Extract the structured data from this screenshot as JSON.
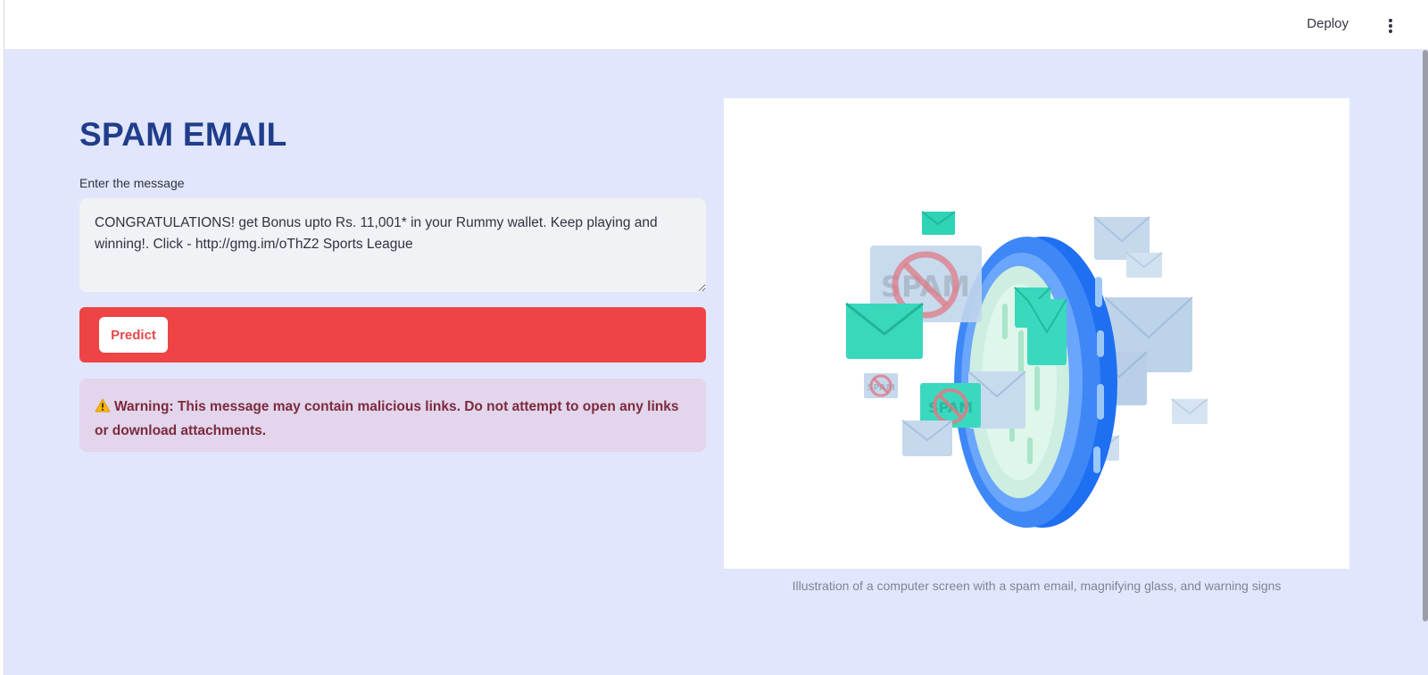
{
  "header": {
    "deploy_label": "Deploy",
    "menu_icon": "kebab-menu-icon"
  },
  "main": {
    "title": "SPAM EMAIL",
    "input": {
      "label": "Enter the message",
      "value": "CONGRATULATIONS! get Bonus upto Rs. 11,001* in your Rummy wallet. Keep playing and winning!. Click - http://gmg.im/oThZ2 Sports League"
    },
    "predict_button": "Predict",
    "result": {
      "icon": "warning-icon",
      "text": "Warning: This message may contain malicious links. Do not attempt to open any links or download attachments."
    },
    "illustration": {
      "spam_text": "SPAM",
      "caption": "Illustration of a computer screen with a spam email, magnifying glass, and warning signs"
    }
  },
  "colors": {
    "background": "#e1e6fc",
    "title": "#1f3d8a",
    "predict_bar": "#ee4445",
    "warning_bg": "#e2d5ec",
    "warning_text": "#7d2a3c"
  }
}
